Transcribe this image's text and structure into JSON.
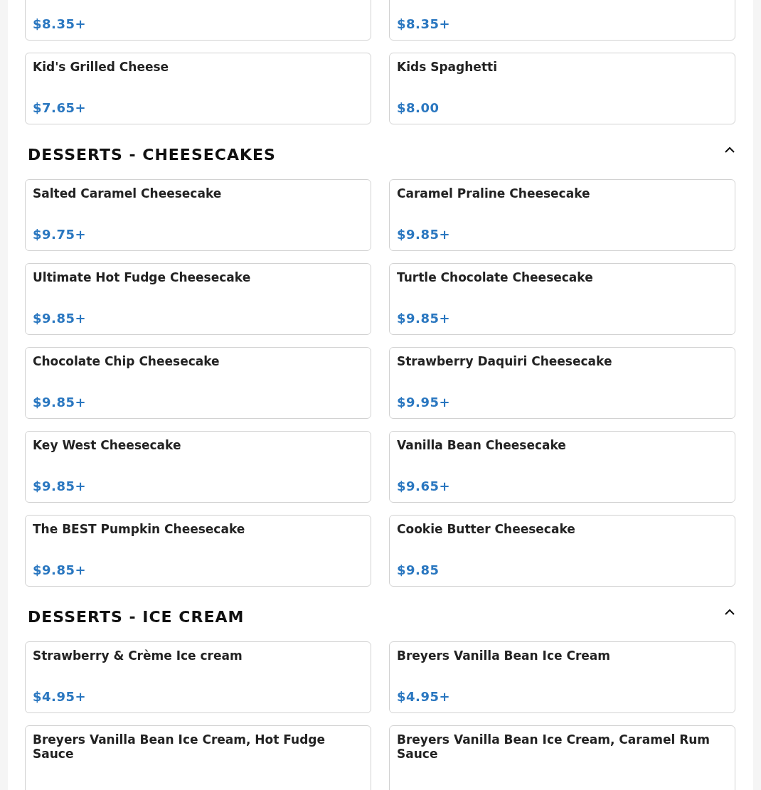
{
  "sections": [
    {
      "items": [
        {
          "price": "$8.35+"
        },
        {
          "price": "$8.35+"
        },
        {
          "name": "Kid's Grilled Cheese",
          "price": "$7.65+"
        },
        {
          "name": "Kids Spaghetti",
          "price": "$8.00"
        }
      ]
    },
    {
      "title": "DESSERTS - CHEESECAKES",
      "expanded": true,
      "items": [
        {
          "name": "Salted Caramel Cheesecake",
          "price": "$9.75+"
        },
        {
          "name": "Caramel Praline Cheesecake",
          "price": "$9.85+"
        },
        {
          "name": "Ultimate Hot Fudge Cheesecake",
          "price": "$9.85+"
        },
        {
          "name": "Turtle Chocolate Cheesecake",
          "price": "$9.85+"
        },
        {
          "name": "Chocolate Chip Cheesecake",
          "price": "$9.85+"
        },
        {
          "name": "Strawberry Daquiri Cheesecake",
          "price": "$9.95+"
        },
        {
          "name": "Key West Cheesecake",
          "price": "$9.85+"
        },
        {
          "name": "Vanilla Bean Cheesecake",
          "price": "$9.65+"
        },
        {
          "name": "The BEST Pumpkin Cheesecake",
          "price": "$9.85+"
        },
        {
          "name": "Cookie Butter Cheesecake",
          "price": "$9.85"
        }
      ]
    },
    {
      "title": "DESSERTS - ICE CREAM",
      "expanded": true,
      "items": [
        {
          "name": "Strawberry & Crème Ice cream",
          "price": "$4.95+"
        },
        {
          "name": "Breyers Vanilla Bean Ice Cream",
          "price": "$4.95+"
        },
        {
          "name": "Breyers Vanilla Bean Ice Cream, Hot Fudge Sauce"
        },
        {
          "name": "Breyers Vanilla Bean Ice Cream, Caramel Rum Sauce"
        }
      ]
    }
  ]
}
